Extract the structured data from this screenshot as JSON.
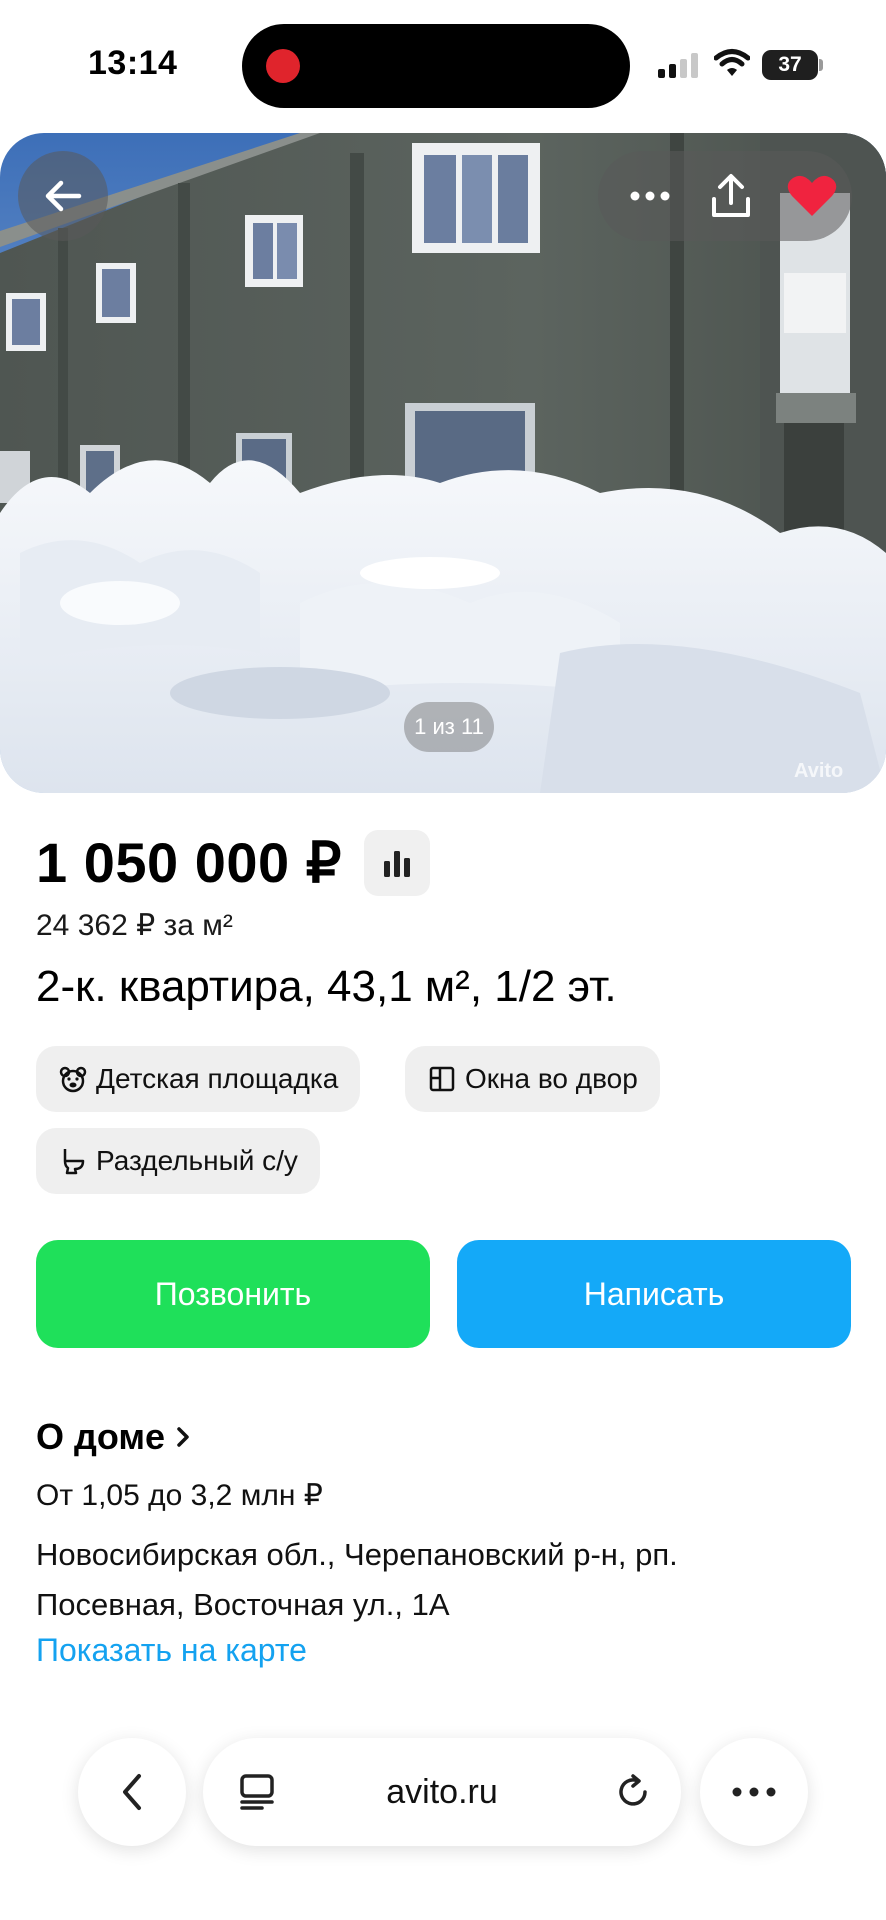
{
  "status_bar": {
    "time": "13:14",
    "battery": "37"
  },
  "gallery": {
    "counter": "1 из 11",
    "watermark": "Avito",
    "back_icon": "arrow-left-icon",
    "more_icon": "more-dots-icon",
    "share_icon": "share-icon",
    "favorite_icon": "heart-icon",
    "favorite_color": "#f0233f"
  },
  "listing": {
    "price": "1 050 000 ₽",
    "price_per_m": "24 362 ₽ за м²",
    "title": "2-к. квартира, 43,1 м², 1/2 эт.",
    "features": [
      {
        "label": "Детская площадка",
        "icon": "teddy-bear-icon"
      },
      {
        "label": "Окна во двор",
        "icon": "window-icon"
      },
      {
        "label": "Раздельный с/у",
        "icon": "toilet-icon"
      }
    ]
  },
  "actions": {
    "call_label": "Позвонить",
    "call_color": "#1fe05a",
    "write_label": "Написать",
    "write_color": "#14a9f8"
  },
  "house": {
    "title": "О доме",
    "price_range": "От 1,05 до 3,2 млн ₽",
    "address": "Новосибирская обл., Черепановский р-н, рп. Посевная, Восточная ул., 1А",
    "map_link": "Показать на карте",
    "link_color": "#14a2f0"
  },
  "browser": {
    "url": "avito.ru",
    "back_icon": "chevron-left-icon",
    "tabs_icon": "tabs-icon",
    "reload_icon": "reload-icon",
    "more_icon": "more-dots-icon"
  }
}
